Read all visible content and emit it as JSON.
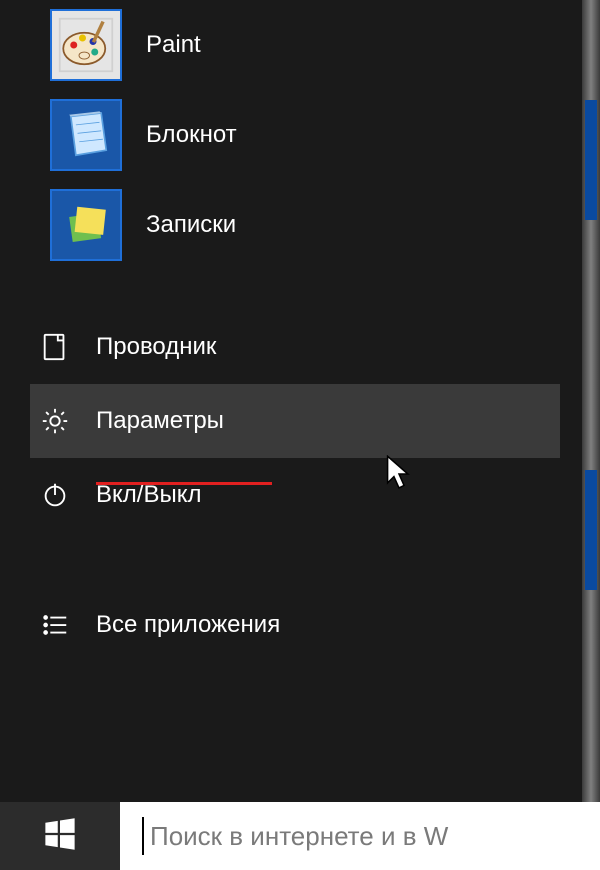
{
  "apps": {
    "items": [
      {
        "label": "Paint",
        "tile": "paint-icon"
      },
      {
        "label": "Блокнот",
        "tile": "notepad-icon"
      },
      {
        "label": "Записки",
        "tile": "sticky-notes-icon"
      }
    ]
  },
  "system": {
    "explorer": {
      "label": "Проводник"
    },
    "settings": {
      "label": "Параметры",
      "highlighted": true
    },
    "power": {
      "label": "Вкл/Выкл"
    },
    "all_apps": {
      "label": "Все приложения"
    }
  },
  "taskbar": {
    "search_placeholder": "Поиск в интернете и в W"
  },
  "colors": {
    "accent": "#1a57a8",
    "annotation_underline": "#e12020",
    "background": "#1a1a1a"
  }
}
